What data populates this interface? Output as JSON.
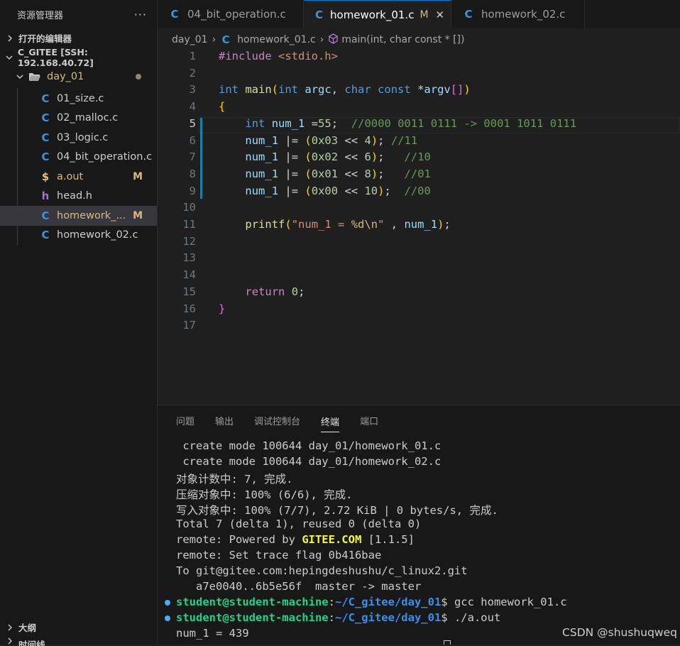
{
  "sidebar": {
    "title": "资源管理器",
    "more": "···",
    "open_editors": "打开的编辑器",
    "workspace": "C_GITEE [SSH: 192.168.40.72]",
    "folder": "day_01",
    "files": [
      {
        "name": "01_size.c",
        "icon": "c-file-icon",
        "badge": ""
      },
      {
        "name": "02_malloc.c",
        "icon": "c-file-icon",
        "badge": ""
      },
      {
        "name": "03_logic.c",
        "icon": "c-file-icon",
        "badge": ""
      },
      {
        "name": "04_bit_operation.c",
        "icon": "c-file-icon",
        "badge": ""
      },
      {
        "name": "a.out",
        "icon": "binary-file-icon",
        "badge": "M"
      },
      {
        "name": "head.h",
        "icon": "h-file-icon",
        "badge": ""
      },
      {
        "name": "homework_...",
        "icon": "c-file-icon",
        "badge": "M"
      },
      {
        "name": "homework_02.c",
        "icon": "c-file-icon",
        "badge": ""
      }
    ],
    "outline": "大纲",
    "timeline": "时间线"
  },
  "tabs": [
    {
      "label": "04_bit_operation.c",
      "modified": "",
      "active": false
    },
    {
      "label": "homework_01.c",
      "modified": "M",
      "active": true
    },
    {
      "label": "homework_02.c",
      "modified": "",
      "active": false
    }
  ],
  "breadcrumb": {
    "folder": "day_01",
    "file": "homework_01.c",
    "symbol": "main(int, char const * [])"
  },
  "editor": {
    "current_line": 5,
    "line_numbers": [
      "1",
      "2",
      "3",
      "4",
      "5",
      "6",
      "7",
      "8",
      "9",
      "10",
      "11",
      "12",
      "13",
      "14",
      "15",
      "16",
      "17"
    ],
    "lines": [
      "#include <stdio.h>",
      "",
      "int main(int argc, char const *argv[])",
      "{",
      "    int num_1 =55;  //0000 0011 0111 -> 0001 1011 0111",
      "    num_1 |= (0x03 << 4); //11",
      "    num_1 |= (0x02 << 6);   //10",
      "    num_1 |= (0x01 << 8);   //01",
      "    num_1 |= (0x00 << 10);  //00",
      "",
      "    printf(\"num_1 = %d\\n\" , num_1);",
      "",
      "",
      "",
      "    return 0;",
      "}",
      ""
    ]
  },
  "panel": {
    "tabs": [
      "问题",
      "输出",
      "调试控制台",
      "终端",
      "端口"
    ],
    "active_tab": "终端",
    "terminal_lines": [
      " create mode 100644 day_01/homework_01.c",
      " create mode 100644 day_01/homework_02.c",
      "对象计数中: 7, 完成.",
      "压缩对象中: 100% (6/6), 完成.",
      "写入对象中: 100% (7/7), 2.72 KiB | 0 bytes/s, 完成.",
      "Total 7 (delta 1), reused 0 (delta 0)",
      "remote: Powered by ",
      "remote: Set trace flag 0b416bae",
      "To git@gitee.com:hepingdeshushu/c_linux2.git",
      "   a7e0040..6b5e56f  master -> master"
    ],
    "gitee_text": "GITEE.COM",
    "gitee_suffix": " [1.1.5]",
    "prompt_user": "student@student-machine",
    "prompt_sep": ":",
    "prompt_path": "~/C_gitee/day_01",
    "prompt_dollar": "$ ",
    "commands": [
      "gcc homework_01.c",
      "./a.out"
    ],
    "output": "num_1 = 439"
  },
  "watermark": "CSDN @shushuqweq"
}
